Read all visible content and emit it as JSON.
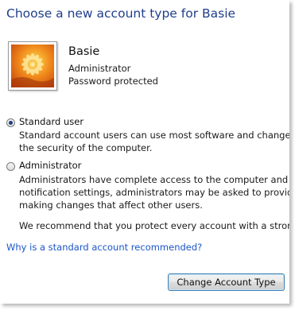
{
  "header": {
    "title": "Choose a new account type for Basie"
  },
  "account": {
    "name": "Basie",
    "type": "Administrator",
    "status": "Password protected",
    "avatar_icon": "flower-avatar-icon"
  },
  "options": [
    {
      "label": "Standard user",
      "selected": true,
      "description": [
        "Standard account users can use most software and change syste",
        "the security of the computer."
      ]
    },
    {
      "label": "Administrator",
      "selected": false,
      "description": [
        "Administrators have complete access to the computer and can m",
        "notification settings, administrators may be asked to provide the",
        "making changes that affect other users."
      ]
    }
  ],
  "recommendation": "We recommend that you protect every account with a strong pa",
  "help_link": "Why is a standard account recommended?",
  "actions": {
    "change_button": "Change Account Type"
  },
  "colors": {
    "heading": "#1e3f8c",
    "link": "#1a55c8",
    "button_border": "#3c7fb1"
  }
}
